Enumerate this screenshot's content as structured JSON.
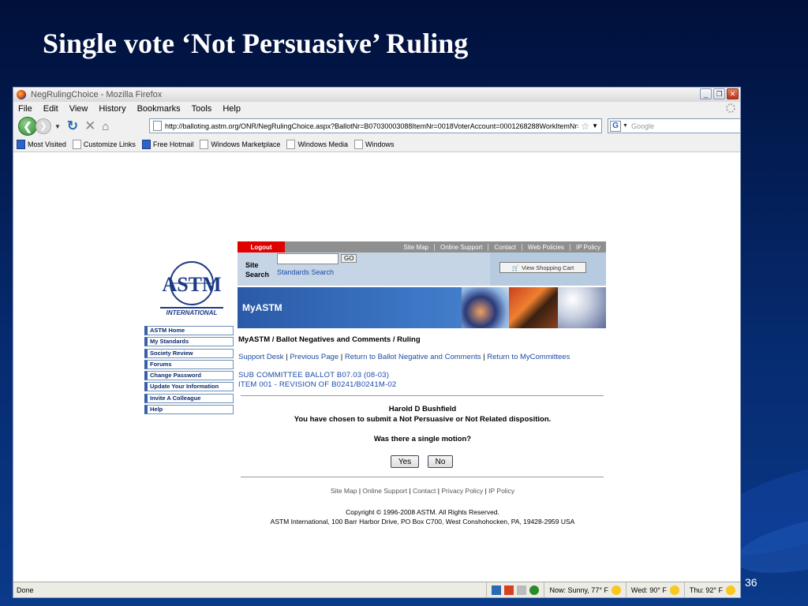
{
  "slide": {
    "title": "Single vote ‘Not Persuasive’ Ruling",
    "number": "36"
  },
  "browser": {
    "window_title": "NegRulingChoice - Mozilla Firefox",
    "menu": [
      "File",
      "Edit",
      "View",
      "History",
      "Bookmarks",
      "Tools",
      "Help"
    ],
    "url": "http://balloting.astm.org/ONR/NegRulingChoice.aspx?BallotNr=B07030003088ItemNr=0018VoterAccount=0001268288WorkItemNr=",
    "search_placeholder": "Google",
    "bookmarks": [
      "Most Visited",
      "Customize Links",
      "Free Hotmail",
      "Windows Marketplace",
      "Windows Media",
      "Windows"
    ],
    "status": "Done",
    "weather": [
      "Now: Sunny, 77° F",
      "Wed: 90° F",
      "Thu: 92° F"
    ]
  },
  "page": {
    "logout": "Logout",
    "top_links": [
      "Site Map",
      "Online Support",
      "Contact",
      "Web Policies",
      "IP Policy"
    ],
    "site_search_label_1": "Site",
    "site_search_label_2": "Search",
    "go": "GO",
    "standards_search": "Standards Search",
    "view_cart": "View Shopping Cart",
    "banner_title": "MyASTM",
    "logo_text": "INTERNATIONAL",
    "side_nav": [
      "ASTM Home",
      "My Standards",
      "Society Review",
      "Forums",
      "Change Password",
      "Update Your Information",
      "Invite A Colleague",
      "Help"
    ],
    "breadcrumb": "MyASTM / Ballot Negatives and Comments / Ruling",
    "links": [
      "Support Desk",
      "Previous Page",
      "Return to Ballot Negative and Comments",
      "Return to MyCommittees"
    ],
    "ballot_line": "SUB COMMITTEE BALLOT B07.03 (08-03)",
    "item_line": "ITEM 001 - REVISION OF B0241/B0241M-02",
    "voter": "Harold D Bushfield",
    "disposition": "You have chosen to submit a Not Persuasive or Not Related disposition.",
    "question": "Was there a single motion?",
    "yes": "Yes",
    "no": "No",
    "footer_links": [
      "Site Map",
      "Online Support",
      "Contact",
      "Privacy Policy",
      "IP Policy"
    ],
    "copyright": "Copyright © 1996-2008 ASTM. All Rights Reserved.",
    "address": "ASTM International, 100 Barr Harbor Drive, PO Box C700, West Conshohocken, PA, 19428-2959 USA"
  }
}
